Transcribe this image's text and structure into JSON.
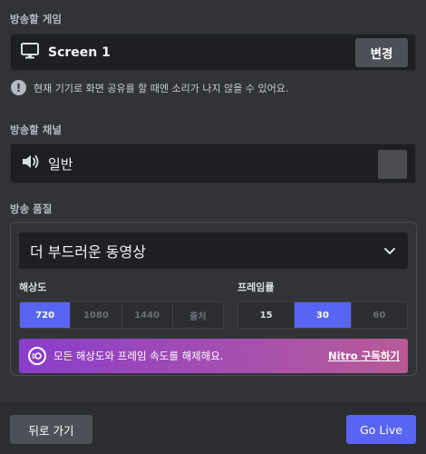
{
  "sections": {
    "game_label": "방송할 게임",
    "channel_label": "방송할 채널",
    "quality_label": "방송 품질"
  },
  "game": {
    "name": "Screen 1",
    "change_button": "변경",
    "icon": "monitor-icon"
  },
  "warning": {
    "icon": "exclamation-icon",
    "text": "현재 기기로 화면 공유를 할 때엔 소리가 나지 않을 수 있어요."
  },
  "channel": {
    "name": "일반",
    "icon": "speaker-icon"
  },
  "quality": {
    "selected": "더 부드러운 동영상",
    "resolution_label": "해상도",
    "resolution_options": [
      "720",
      "1080",
      "1440",
      "출처"
    ],
    "resolution_selected": "720",
    "framerate_label": "프레임률",
    "framerate_options": [
      "15",
      "30",
      "60"
    ],
    "framerate_selected": "30"
  },
  "nitro": {
    "text": "모든 해상도와 프레임 속도를 해제해요.",
    "link": "Nitro 구독하기",
    "icon": "nitro-icon"
  },
  "footer": {
    "back_button": "뒤로 가기",
    "golive_button": "Go Live"
  },
  "colors": {
    "accent": "#5865f2",
    "background": "#313338",
    "nitro_gradient_start": "#8a3dc9",
    "nitro_gradient_end": "#b85a96"
  }
}
